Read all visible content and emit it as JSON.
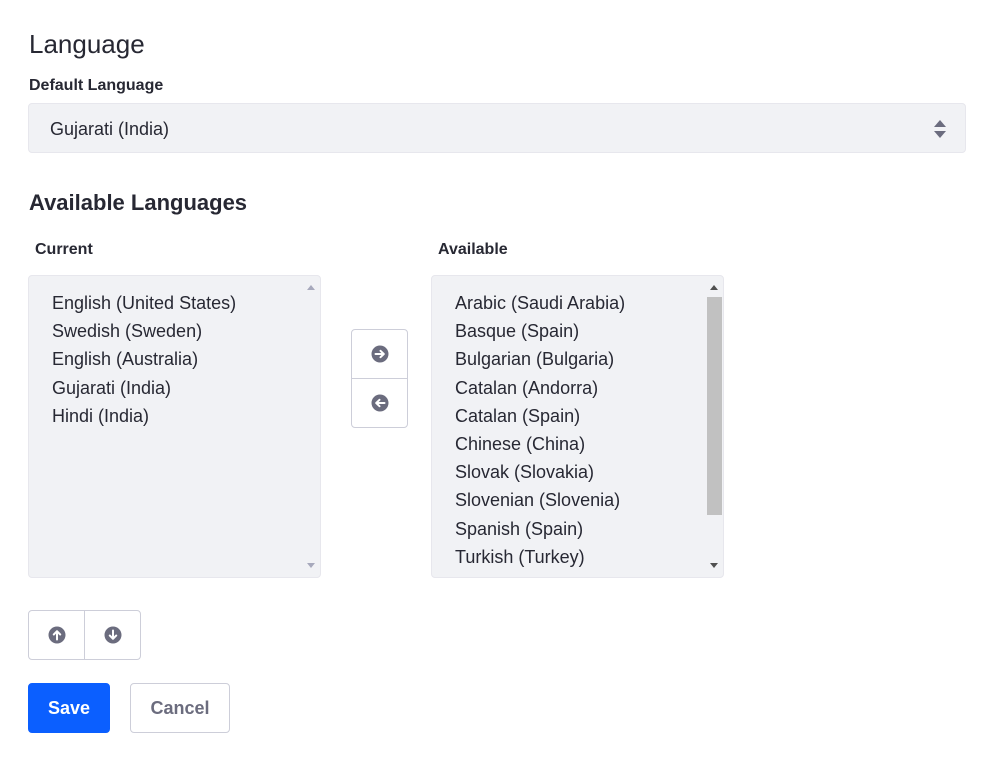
{
  "language_section": {
    "title": "Language",
    "default_language_label": "Default Language",
    "default_language_value": "Gujarati (India)"
  },
  "available_section": {
    "title": "Available Languages",
    "current": {
      "label": "Current",
      "items": [
        "English (United States)",
        "Swedish (Sweden)",
        "English (Australia)",
        "Gujarati (India)",
        "Hindi (India)"
      ]
    },
    "available": {
      "label": "Available",
      "items": [
        "Arabic (Saudi Arabia)",
        "Basque (Spain)",
        "Bulgarian (Bulgaria)",
        "Catalan (Andorra)",
        "Catalan (Spain)",
        "Chinese (China)",
        "Slovak (Slovakia)",
        "Slovenian (Slovenia)",
        "Spanish (Spain)",
        "Turkish (Turkey)"
      ]
    },
    "transfer_buttons": {
      "move_right_icon": "arrow-right-circle-icon",
      "move_left_icon": "arrow-left-circle-icon"
    },
    "reorder_buttons": {
      "move_up_icon": "arrow-up-circle-icon",
      "move_down_icon": "arrow-down-circle-icon"
    }
  },
  "actions": {
    "save_label": "Save",
    "cancel_label": "Cancel"
  },
  "colors": {
    "primary": "#0b5fff",
    "field_background": "#f1f2f5",
    "icon": "#6b6c7e",
    "text": "#272833"
  }
}
